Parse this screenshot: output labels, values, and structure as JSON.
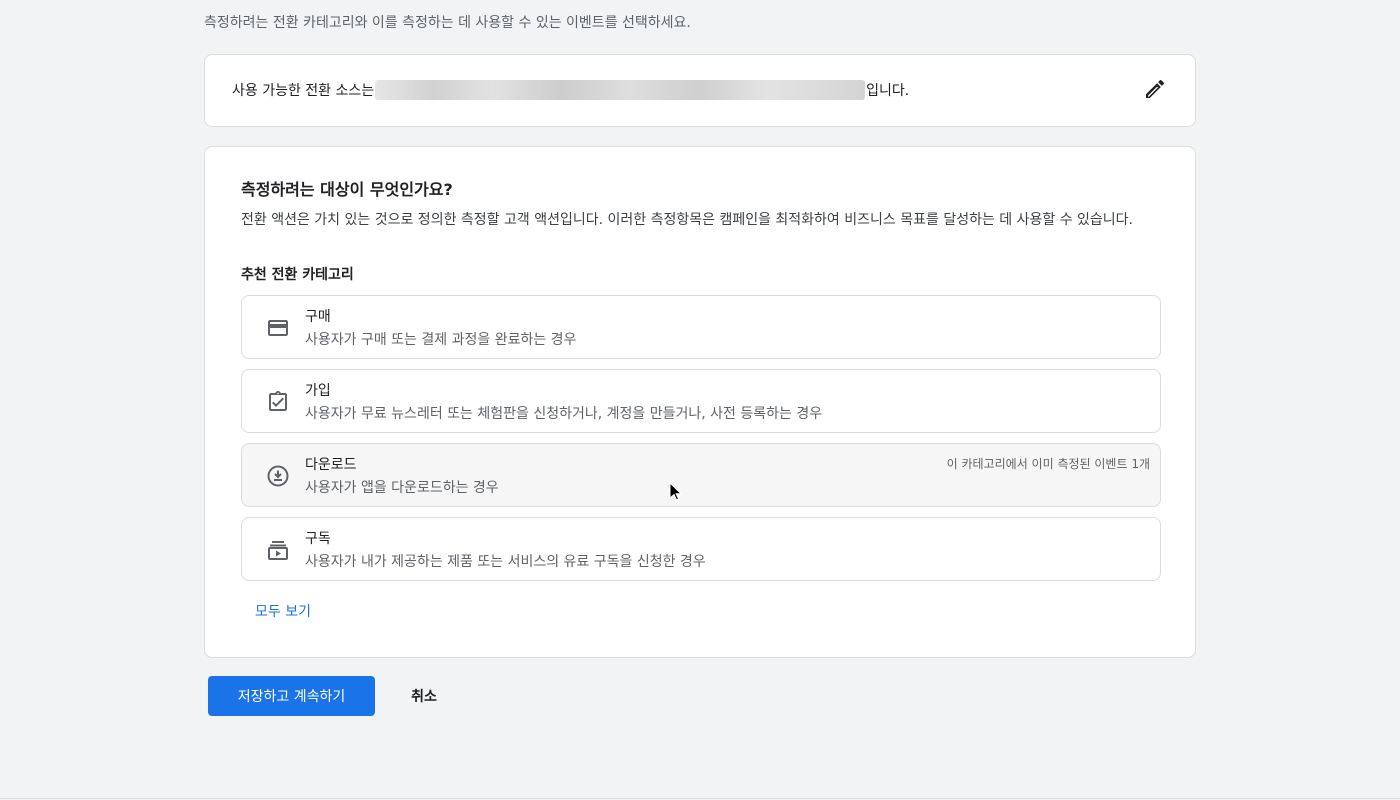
{
  "intro_text": "측정하려는 전환 카테고리와 이를 측정하는 데 사용할 수 있는 이벤트를 선택하세요.",
  "source": {
    "prefix": "사용 가능한 전환 소스는",
    "suffix": "입니다.",
    "edit_icon": "pencil-icon"
  },
  "main": {
    "title": "측정하려는 대상이 무엇인가요?",
    "description": "전환 액션은 가치 있는 것으로 정의한 측정할 고객 액션입니다. 이러한 측정항목은 캠페인을 최적화하여 비즈니스 목표를 달성하는 데 사용할 수 있습니다.",
    "section_label": "추천 전환 카테고리",
    "options": [
      {
        "title": "구매",
        "description": "사용자가 구매 또는 결제 과정을 완료하는 경우",
        "icon": "credit-card-icon",
        "note": ""
      },
      {
        "title": "가입",
        "description": "사용자가 무료 뉴스레터 또는 체험판을 신청하거나, 계정을 만들거나, 사전 등록하는 경우",
        "icon": "clipboard-check-icon",
        "note": ""
      },
      {
        "title": "다운로드",
        "description": "사용자가 앱을 다운로드하는 경우",
        "icon": "download-circle-icon",
        "note": "이 카테고리에서 이미 측정된 이벤트 1개"
      },
      {
        "title": "구독",
        "description": "사용자가 내가 제공하는 제품 또는 서비스의 유료 구독을 신청한 경우",
        "icon": "subscriptions-icon",
        "note": ""
      }
    ],
    "view_all": "모두 보기"
  },
  "actions": {
    "save_label": "저장하고 계속하기",
    "cancel_label": "취소"
  },
  "colors": {
    "accent": "#1a73e8",
    "background": "#f1f3f4",
    "card": "#ffffff",
    "border": "#dadce0"
  }
}
